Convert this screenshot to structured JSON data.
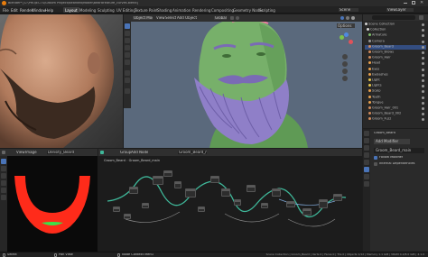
{
  "app": {
    "title": "Blender* [C:\\PROJECTS\\Groom Project\\Bearded\\Model\\BeardFeature_curves.blend]",
    "menus": [
      "File",
      "Edit",
      "Render",
      "Window",
      "Help"
    ],
    "workspaces": [
      "Layout",
      "Modeling",
      "Sculpting",
      "UV Editing",
      "Texture Paint",
      "Shading",
      "Animation",
      "Rendering",
      "Compositing",
      "Geometry Nodes",
      "Scripting"
    ],
    "active_workspace": "Layout",
    "scene": "Scene",
    "view_layer": "ViewLayer"
  },
  "viewport": {
    "mode": "Object Mode",
    "menus": [
      "View",
      "Select",
      "Add",
      "Object"
    ],
    "orientation": "Global",
    "options_label": "Options"
  },
  "outliner": {
    "rows": [
      "Scene Collection",
      "Collection",
      "Armature",
      "Camera",
      "Groom_Beard",
      "Groom_Brows",
      "Groom_Hair",
      "Head",
      "Eyes",
      "Eyelashes",
      "Light",
      "Lights",
      "Scalp",
      "Teeth",
      "Tongue",
      "Groom_Hair_001",
      "Groom_Beard_002",
      "Groom_Fuzz"
    ]
  },
  "properties": {
    "object_name": "Groom_Beard",
    "modifier_label": "Add Modifier",
    "modifier": "Groom_Beard_main",
    "rows": [
      "Follow Modifier",
      "Internal Dependencies"
    ]
  },
  "texpaint": {
    "header": [
      "View",
      "Image"
    ],
    "image_name": "Density_Beard",
    "mode": "Texture Paint"
  },
  "node_editor": {
    "header": [
      "Group",
      "Add",
      "Node"
    ],
    "object": "Groom_Beard",
    "tree": "Groom_Beard_main"
  },
  "status": {
    "left": [
      "Select",
      "Pan View",
      "Node Context Menu"
    ],
    "right": "Scene Collection | Groom_Beard | Verts 0 | Faces 0 | Tris 0 | Objects 1/12 | Memory 1.1 GiB | VRAM 4.2/8.0 GiB | 4.1.0"
  },
  "colors": {
    "viewport_bg": "#59687a",
    "accent": "#4a74b8",
    "beard_curve": "#8f7fc8",
    "head_mesh": "#77b06a",
    "noodle": "#3fb89a",
    "density_mask": "#ff2b1a"
  }
}
